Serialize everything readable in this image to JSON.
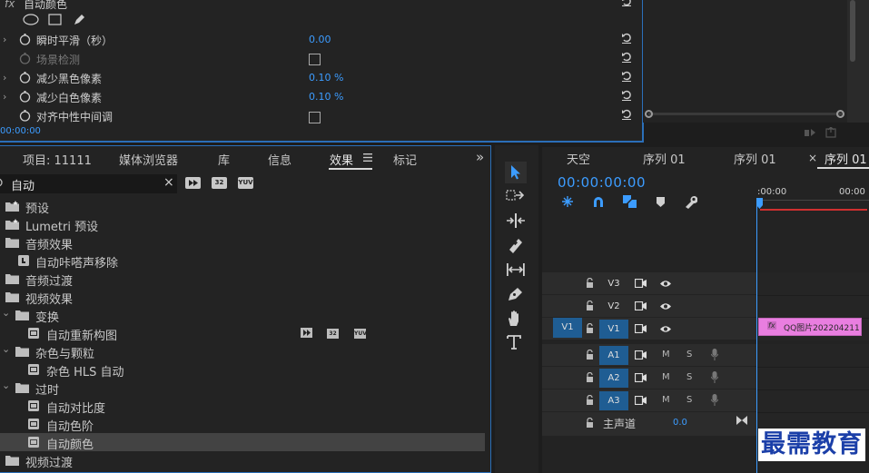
{
  "effect_controls": {
    "effect_name": "自动颜色",
    "rows": [
      {
        "label": "瞬时平滑（秒）",
        "value": "0.00",
        "type": "value"
      },
      {
        "label": "场景检测",
        "value": "",
        "type": "checkbox"
      },
      {
        "label": "减少黑色像素",
        "value": "0.10 %",
        "type": "value"
      },
      {
        "label": "减少白色像素",
        "value": "0.10 %",
        "type": "value"
      },
      {
        "label": "对齐中性中间调",
        "value": "",
        "type": "checkbox"
      }
    ],
    "timecode": "00:00:00"
  },
  "effects_panel": {
    "tabs": [
      "项目: 11111",
      "媒体浏览器",
      "库",
      "信息",
      "效果",
      "标记"
    ],
    "active_tab": "效果",
    "overflow_symbol": "»",
    "search_value": "自动",
    "filter_badges": [
      "32",
      "YUV"
    ],
    "tree": [
      {
        "label": "预设",
        "kind": "preset"
      },
      {
        "label": "Lumetri 预设",
        "kind": "preset"
      },
      {
        "label": "音频效果",
        "kind": "folder"
      },
      {
        "label": "自动咔嗒声移除",
        "kind": "effect"
      },
      {
        "label": "音频过渡",
        "kind": "folder"
      },
      {
        "label": "视频效果",
        "kind": "folder"
      },
      {
        "label": "变换",
        "kind": "subfolder"
      },
      {
        "label": "自动重新构图",
        "kind": "effect2"
      },
      {
        "label": "杂色与颗粒",
        "kind": "subfolder"
      },
      {
        "label": "杂色 HLS 自动",
        "kind": "effect2"
      },
      {
        "label": "过时",
        "kind": "subfolder"
      },
      {
        "label": "自动对比度",
        "kind": "effect2"
      },
      {
        "label": "自动色阶",
        "kind": "effect2"
      },
      {
        "label": "自动颜色",
        "kind": "effect2",
        "selected": true
      },
      {
        "label": "视频过渡",
        "kind": "folder"
      }
    ]
  },
  "timeline": {
    "tabs": [
      "天空",
      "序列 01",
      "序列 01",
      "序列 01"
    ],
    "close_symbol": "×",
    "active_tab_index": 3,
    "timecode": "00:00:00:00",
    "ruler_labels": [
      ":00:00",
      "00:00"
    ],
    "tracks": [
      "V3",
      "V2",
      "V1",
      "A1",
      "A2",
      "A3"
    ],
    "source_v1": "V1",
    "master_label": "主声道",
    "master_value": "0.0",
    "track_markers": [
      "M",
      "S"
    ],
    "clip_fx": "fx",
    "clip_name": "QQ图片202204211"
  },
  "watermark": "最需教育",
  "colors": {
    "accent": "#3c9cff",
    "track_on": "#1f5d93",
    "clip": "#e97ee0",
    "playhead_bar": "#d03030"
  }
}
